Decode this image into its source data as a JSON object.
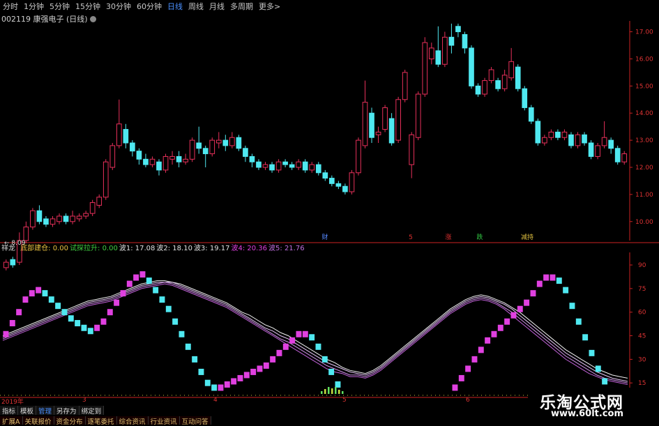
{
  "toolbar": {
    "tabs": [
      "分时",
      "1分钟",
      "5分钟",
      "15分钟",
      "30分钟",
      "60分钟",
      "日线",
      "周线",
      "月线",
      "多周期",
      "更多>"
    ],
    "active_tab": "日线"
  },
  "stock": {
    "title": "002119 康强电子 (日线)"
  },
  "colors": {
    "up": "#e8305a",
    "down": "#4fe8f0",
    "axis": "#cc2222",
    "up_bar": "#e040e0"
  },
  "price_chart": {
    "min_label": "8.09",
    "markers": [
      "财",
      "5",
      "涨",
      "跌",
      "减持"
    ],
    "marker_colors": [
      "#5588ff",
      "#e03030",
      "#e03030",
      "#30c040",
      "#e0c040"
    ]
  },
  "chart_data": [
    {
      "type": "candlestick",
      "yticks": [
        10.0,
        11.0,
        12.0,
        13.0,
        14.0,
        15.0,
        16.0,
        17.0
      ],
      "ylim": [
        9.3,
        17.4
      ],
      "ytick_labels": [
        "10.00",
        "11.00",
        "12.00",
        "13.00",
        "14.00",
        "15.00",
        "16.00",
        "17.00"
      ],
      "min_annotation": 8.09,
      "candles": [
        [
          8.3,
          8.5,
          8.2,
          8.6
        ],
        [
          8.6,
          8.4,
          8.3,
          8.7
        ],
        [
          8.5,
          9.3,
          8.4,
          9.6
        ],
        [
          9.3,
          9.8,
          9.2,
          10.0
        ],
        [
          9.8,
          10.4,
          9.7,
          10.5
        ],
        [
          10.4,
          10.0,
          9.9,
          10.6
        ],
        [
          10.1,
          9.9,
          9.8,
          10.2
        ],
        [
          9.9,
          10.1,
          9.8,
          10.2
        ],
        [
          10.0,
          10.2,
          9.9,
          10.3
        ],
        [
          10.2,
          10.0,
          9.9,
          10.3
        ],
        [
          10.0,
          10.2,
          9.9,
          10.4
        ],
        [
          10.1,
          10.2,
          10.0,
          10.3
        ],
        [
          10.2,
          10.3,
          10.1,
          10.4
        ],
        [
          10.3,
          10.7,
          10.2,
          10.8
        ],
        [
          10.6,
          10.9,
          10.5,
          11.0
        ],
        [
          10.9,
          12.2,
          10.8,
          12.3
        ],
        [
          12.0,
          12.8,
          11.9,
          12.9
        ],
        [
          12.8,
          13.6,
          12.7,
          14.5
        ],
        [
          13.4,
          12.9,
          12.7,
          13.6
        ],
        [
          12.9,
          12.6,
          12.4,
          13.0
        ],
        [
          12.6,
          12.3,
          12.1,
          12.7
        ],
        [
          12.3,
          12.1,
          12.0,
          12.5
        ],
        [
          12.1,
          12.3,
          12.0,
          12.4
        ],
        [
          12.2,
          11.9,
          11.7,
          12.3
        ],
        [
          11.9,
          12.4,
          11.8,
          12.5
        ],
        [
          12.3,
          12.4,
          12.1,
          12.6
        ],
        [
          12.4,
          12.2,
          12.0,
          12.6
        ],
        [
          12.2,
          12.3,
          12.1,
          12.5
        ],
        [
          12.3,
          13.0,
          12.2,
          13.1
        ],
        [
          12.9,
          12.7,
          12.5,
          13.5
        ],
        [
          12.7,
          12.5,
          12.0,
          12.8
        ],
        [
          12.5,
          13.0,
          12.4,
          13.1
        ],
        [
          12.9,
          13.0,
          12.7,
          13.3
        ],
        [
          13.0,
          12.8,
          12.6,
          13.2
        ],
        [
          12.8,
          13.1,
          12.7,
          13.3
        ],
        [
          13.1,
          12.7,
          12.6,
          13.2
        ],
        [
          12.7,
          12.4,
          12.2,
          12.8
        ],
        [
          12.4,
          12.2,
          12.0,
          12.5
        ],
        [
          12.2,
          12.0,
          11.9,
          12.3
        ],
        [
          12.0,
          12.1,
          11.9,
          12.2
        ],
        [
          12.1,
          11.9,
          11.8,
          12.2
        ],
        [
          11.9,
          12.2,
          11.8,
          12.3
        ],
        [
          12.2,
          12.1,
          12.0,
          12.3
        ],
        [
          12.1,
          12.0,
          11.9,
          12.2
        ],
        [
          12.0,
          12.2,
          11.9,
          12.3
        ],
        [
          12.2,
          11.9,
          11.8,
          12.3
        ],
        [
          11.9,
          12.1,
          11.8,
          12.2
        ],
        [
          12.1,
          11.8,
          11.7,
          12.2
        ],
        [
          11.8,
          11.6,
          11.5,
          11.9
        ],
        [
          11.6,
          11.4,
          11.3,
          11.7
        ],
        [
          11.4,
          11.3,
          11.2,
          11.5
        ],
        [
          11.3,
          11.1,
          11.0,
          11.4
        ],
        [
          11.1,
          11.8,
          11.0,
          11.9
        ],
        [
          11.8,
          13.0,
          11.7,
          13.1
        ],
        [
          12.8,
          14.4,
          12.7,
          15.2
        ],
        [
          14.0,
          13.1,
          12.9,
          14.2
        ],
        [
          13.2,
          13.3,
          12.9,
          13.5
        ],
        [
          13.4,
          14.2,
          13.3,
          14.3
        ],
        [
          13.8,
          12.9,
          12.8,
          14.0
        ],
        [
          13.0,
          14.5,
          12.9,
          14.6
        ],
        [
          14.5,
          15.5,
          14.4,
          15.6
        ],
        [
          12.1,
          13.2,
          11.6,
          13.3
        ],
        [
          13.1,
          14.7,
          13.0,
          14.8
        ],
        [
          14.7,
          16.6,
          14.6,
          16.8
        ],
        [
          16.0,
          16.4,
          15.8,
          16.6
        ],
        [
          16.3,
          15.8,
          15.7,
          17.2
        ],
        [
          15.8,
          16.8,
          15.7,
          17.0
        ],
        [
          16.8,
          16.5,
          16.2,
          17.3
        ],
        [
          17.2,
          17.0,
          16.8,
          17.3
        ],
        [
          16.9,
          16.4,
          16.2,
          17.0
        ],
        [
          16.4,
          15.0,
          14.9,
          16.5
        ],
        [
          15.0,
          14.7,
          14.6,
          15.1
        ],
        [
          14.7,
          15.2,
          14.6,
          15.3
        ],
        [
          15.2,
          15.6,
          15.1,
          15.7
        ],
        [
          15.2,
          14.9,
          14.8,
          15.3
        ],
        [
          14.9,
          15.4,
          14.8,
          15.6
        ],
        [
          15.3,
          15.9,
          15.2,
          16.4
        ],
        [
          15.7,
          14.9,
          14.8,
          15.8
        ],
        [
          14.9,
          14.2,
          14.1,
          15.0
        ],
        [
          14.2,
          13.7,
          13.6,
          14.3
        ],
        [
          13.7,
          12.9,
          12.8,
          13.8
        ],
        [
          12.9,
          13.1,
          12.8,
          13.2
        ],
        [
          13.1,
          13.3,
          13.0,
          13.4
        ],
        [
          13.3,
          13.1,
          13.0,
          13.4
        ],
        [
          13.1,
          13.3,
          13.0,
          13.4
        ],
        [
          13.2,
          12.8,
          12.7,
          13.3
        ],
        [
          12.8,
          13.2,
          12.7,
          13.3
        ],
        [
          13.2,
          12.9,
          12.8,
          13.3
        ],
        [
          12.9,
          12.4,
          12.3,
          13.0
        ],
        [
          12.4,
          12.8,
          12.3,
          12.9
        ],
        [
          12.8,
          13.1,
          12.7,
          13.7
        ],
        [
          13.0,
          12.7,
          12.5,
          13.1
        ],
        [
          12.7,
          12.2,
          12.1,
          12.8
        ],
        [
          12.2,
          12.5,
          12.1,
          12.6
        ]
      ]
    },
    {
      "type": "bar",
      "title": "祥龙",
      "yticks": [
        15,
        30,
        45,
        60,
        75,
        90
      ],
      "ytick_labels": [
        "15",
        "30",
        "45",
        "60",
        "75",
        "90"
      ],
      "ylim": [
        8,
        98
      ],
      "values": [
        48,
        55,
        62,
        70,
        74,
        76,
        74,
        70,
        66,
        62,
        58,
        55,
        52,
        50,
        52,
        56,
        62,
        68,
        74,
        80,
        84,
        86,
        82,
        76,
        70,
        64,
        56,
        48,
        40,
        32,
        24,
        17,
        14,
        14,
        16,
        18,
        20,
        22,
        24,
        26,
        28,
        32,
        36,
        40,
        44,
        48,
        48,
        46,
        40,
        32,
        24,
        16,
        8,
        8,
        8,
        8,
        8,
        8,
        8,
        8,
        8,
        8,
        8,
        8,
        8,
        8,
        8,
        8,
        8,
        14,
        20,
        26,
        32,
        38,
        44,
        48,
        52,
        56,
        60,
        64,
        68,
        74,
        80,
        84,
        84,
        82,
        76,
        66,
        56,
        46,
        36,
        26,
        18,
        12,
        8,
        8
      ],
      "series": [
        {
          "name": "",
          "values": [
            45,
            47,
            49,
            51,
            53,
            55,
            57,
            59,
            61,
            63,
            65,
            67,
            68,
            69,
            70,
            72,
            74,
            76,
            78,
            79,
            80,
            80,
            79,
            78,
            76,
            74,
            72,
            70,
            68,
            66,
            63,
            60,
            58,
            55,
            52,
            50,
            47,
            45,
            42,
            39,
            36,
            33,
            30,
            28,
            25,
            23,
            22,
            21,
            23,
            26,
            30,
            34,
            38,
            42,
            46,
            50,
            54,
            58,
            62,
            65,
            68,
            70,
            71,
            70,
            68,
            66,
            63,
            60,
            56,
            52,
            48,
            44,
            40,
            36,
            33,
            30,
            27,
            24,
            22,
            20,
            19,
            18
          ]
        },
        {
          "name": "",
          "values": [
            44,
            46,
            48,
            50,
            52,
            54,
            56,
            58,
            60,
            62,
            64,
            66,
            67,
            68,
            69,
            71,
            73,
            75,
            77,
            78,
            79,
            79,
            79,
            77,
            75,
            73,
            71,
            69,
            67,
            65,
            62,
            59,
            56,
            53,
            50,
            48,
            45,
            43,
            40,
            37,
            34,
            31,
            28,
            26,
            24,
            22,
            21,
            20,
            22,
            25,
            29,
            33,
            37,
            41,
            45,
            49,
            53,
            57,
            61,
            64,
            67,
            69,
            70,
            69,
            67,
            65,
            62,
            58,
            54,
            50,
            46,
            42,
            38,
            34,
            31,
            28,
            25,
            22,
            20,
            18,
            17,
            16
          ]
        },
        {
          "name": "",
          "values": [
            43,
            45,
            47,
            49,
            51,
            53,
            55,
            57,
            59,
            61,
            63,
            65,
            66,
            67,
            68,
            70,
            72,
            74,
            76,
            77,
            78,
            79,
            78,
            76,
            74,
            72,
            70,
            68,
            66,
            64,
            61,
            58,
            55,
            52,
            49,
            46,
            43,
            41,
            38,
            35,
            32,
            29,
            26,
            24,
            22,
            20,
            20,
            19,
            21,
            24,
            28,
            32,
            36,
            40,
            44,
            48,
            52,
            56,
            60,
            63,
            66,
            68,
            69,
            68,
            66,
            63,
            60,
            56,
            52,
            48,
            44,
            40,
            36,
            32,
            29,
            26,
            23,
            20,
            18,
            17,
            16,
            15
          ]
        },
        {
          "name": "",
          "values": [
            42,
            44,
            46,
            48,
            50,
            52,
            54,
            56,
            58,
            60,
            62,
            64,
            65,
            66,
            67,
            69,
            71,
            73,
            75,
            76,
            77,
            78,
            77,
            75,
            73,
            71,
            69,
            67,
            65,
            63,
            60,
            57,
            54,
            51,
            48,
            45,
            42,
            39,
            36,
            33,
            30,
            27,
            24,
            22,
            21,
            19,
            19,
            18,
            20,
            23,
            27,
            31,
            35,
            39,
            43,
            47,
            51,
            55,
            59,
            62,
            65,
            67,
            68,
            67,
            65,
            62,
            58,
            54,
            50,
            46,
            42,
            38,
            34,
            30,
            27,
            24,
            21,
            19,
            17,
            16,
            15,
            14
          ]
        }
      ]
    }
  ],
  "indicator": {
    "name": "祥龙",
    "items": [
      {
        "label": "底部建仓: 0.00",
        "color": "#e8c040"
      },
      {
        "label": "试探拉升: 0.00",
        "color": "#40d040"
      },
      {
        "label": "波1: 17.08",
        "color": "#e0e0e0"
      },
      {
        "label": "波2: 18.10",
        "color": "#e0e0e0"
      },
      {
        "label": "波3: 19.17",
        "color": "#e0e0e0"
      },
      {
        "label": "波4: 20.36",
        "color": "#e040e0"
      },
      {
        "label": "波5: 21.76",
        "color": "#c070e0"
      }
    ]
  },
  "date_axis": {
    "labels": [
      "2019年",
      "3",
      "4",
      "5",
      "6"
    ]
  },
  "func_bar": {
    "items": [
      "指标",
      "模板",
      "管理",
      "另存为",
      "绑定到"
    ],
    "active": "管理"
  },
  "bottom_tabs": {
    "items": [
      "扩展A",
      "关联报价",
      "资金分布",
      "逐笔委托",
      "综合资讯",
      "行业资讯",
      "互动问答"
    ]
  },
  "watermark": {
    "name": "乐淘公式网",
    "url": "www.60lt.com"
  }
}
